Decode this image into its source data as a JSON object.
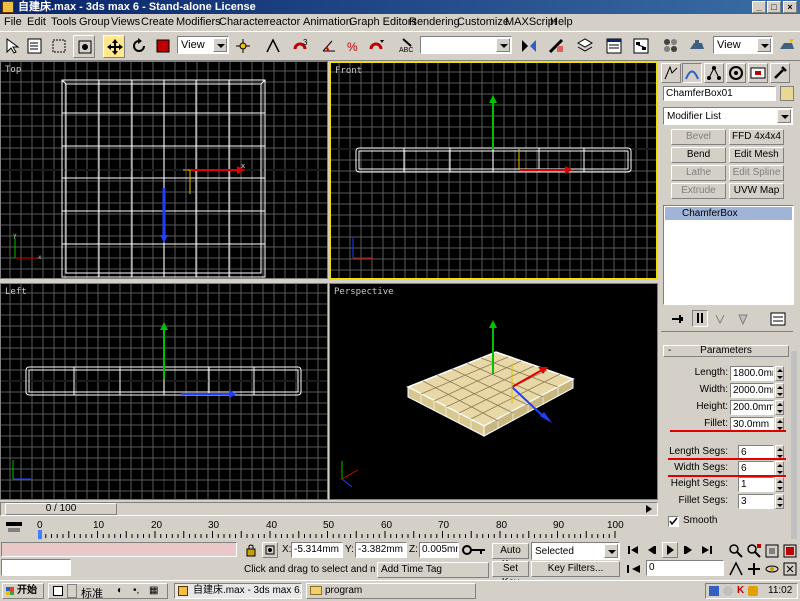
{
  "window": {
    "title": "自建床.max - 3ds max 6 - Stand-alone License",
    "buttons": [
      "_",
      "□",
      "×"
    ]
  },
  "menu": [
    "File",
    "Edit",
    "Tools",
    "Group",
    "Views",
    "Create",
    "Modifiers",
    "Character",
    "reactor",
    "Animation",
    "Graph Editors",
    "Rendering",
    "Customize",
    "MAXScript",
    "Help"
  ],
  "toolbar": {
    "view_dropdown_1": "View",
    "view_dropdown_2": "View",
    "named_selection": "",
    "icons": [
      "select-link-icon",
      "unlink-icon",
      "bind-space-warp-icon",
      "select-object-icon",
      "select-by-name-icon",
      "select-region-icon",
      "select-move-icon",
      "select-rotate-icon",
      "select-scale-icon",
      "pivot-center-icon",
      "snap-3d-icon",
      "angle-snap-icon",
      "percent-snap-icon",
      "spinner-snap-icon",
      "named-selection-icon",
      "mirror-icon",
      "align-icon",
      "layer-manager-icon",
      "curve-editor-icon",
      "schematic-view-icon",
      "material-editor-icon",
      "render-scene-icon",
      "quick-render-icon"
    ]
  },
  "viewports": {
    "top": "Top",
    "front": "Front",
    "left": "Left",
    "perspective": "Perspective"
  },
  "command_panel": {
    "tabs": [
      "create-tab-icon",
      "modify-tab-icon",
      "hierarchy-tab-icon",
      "motion-tab-icon",
      "display-tab-icon",
      "utilities-tab-icon"
    ],
    "object_name": "ChamferBox01",
    "modifier_list": "Modifier List",
    "modifier_buttons": [
      {
        "label": "Bevel",
        "enabled": false
      },
      {
        "label": "FFD 4x4x4",
        "enabled": true
      },
      {
        "label": "Bend",
        "enabled": true
      },
      {
        "label": "Edit Mesh",
        "enabled": true
      },
      {
        "label": "Lathe",
        "enabled": false
      },
      {
        "label": "Edit Spline",
        "enabled": false
      },
      {
        "label": "Extrude",
        "enabled": false
      },
      {
        "label": "UVW Map",
        "enabled": true
      }
    ],
    "stack_item": "ChamferBox",
    "rollout_sign": "-",
    "rollout_title": "Parameters",
    "params": [
      {
        "label": "Length:",
        "value": "1800.0mm"
      },
      {
        "label": "Width:",
        "value": "2000.0mm"
      },
      {
        "label": "Height:",
        "value": "200.0mm"
      },
      {
        "label": "Fillet:",
        "value": "30.0mm"
      },
      {
        "label": "Length Segs:",
        "value": "6"
      },
      {
        "label": "Width Segs:",
        "value": "6"
      },
      {
        "label": "Height Segs:",
        "value": "1"
      },
      {
        "label": "Fillet Segs:",
        "value": "3"
      }
    ],
    "smooth_label": "Smooth",
    "smooth_checked": true
  },
  "timeline": {
    "frame_readout": "0 / 100",
    "ticks": [
      "0",
      "10",
      "20",
      "30",
      "40",
      "50",
      "60",
      "70",
      "80",
      "90",
      "100"
    ]
  },
  "status": {
    "x_label": "X:",
    "x_value": "-5.314mm",
    "y_label": "Y:",
    "y_value": "-3.382mm",
    "z_label": "Z:",
    "z_value": "0.005mm",
    "auto_key": "Auto Key",
    "set_key": "Set Key",
    "selected_dropdown": "Selected",
    "key_filters": "Key Filters...",
    "prompt": "Click and drag to select and move",
    "add_time_tag": "Add Time Tag",
    "current_frame": "0"
  },
  "taskbar": {
    "start": "开始",
    "ime": "标准",
    "tasks": [
      "自建床.max - 3ds max 6...",
      "program"
    ],
    "clock": "11:02"
  },
  "colors": {
    "active_viewport_border": "#f0e000",
    "wire": "#ffffff",
    "grid": "#5a5a5a",
    "grid_axis": "#1a1a1a",
    "mattress": "#e8d8a8",
    "highlight_line": "#e00000"
  }
}
